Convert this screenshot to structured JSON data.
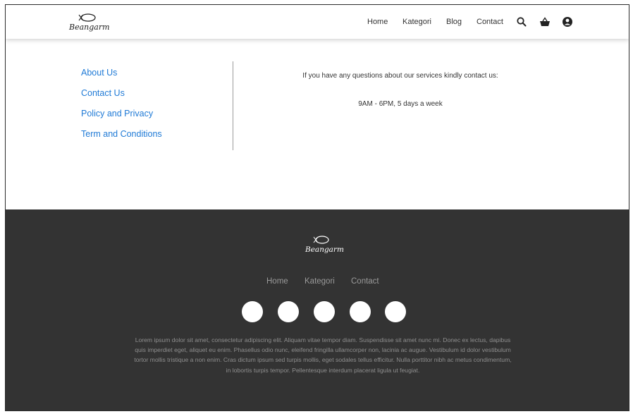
{
  "header": {
    "logo": {
      "text": "Beangarm"
    },
    "nav": [
      {
        "label": "Home"
      },
      {
        "label": "Kategori"
      },
      {
        "label": "Blog"
      },
      {
        "label": "Contact"
      }
    ],
    "icons": [
      "search-icon",
      "basket-icon",
      "user-icon"
    ]
  },
  "info": {
    "links": [
      {
        "label": "About Us"
      },
      {
        "label": "Contact Us"
      },
      {
        "label": "Policy and Privacy"
      },
      {
        "label": "Term and Conditions"
      }
    ],
    "contact_line": "If you have any questions about our services kindly contact us:",
    "hours": "9AM - 6PM, 5 days a week"
  },
  "footer": {
    "logo": {
      "text": "Beangarm"
    },
    "nav": [
      {
        "label": "Home"
      },
      {
        "label": "Kategori"
      },
      {
        "label": "Contact"
      }
    ],
    "social_count": 5,
    "text": "Lorem ipsum dolor sit amet, consectetur adipiscing elit. Aliquam vitae tempor diam. Suspendisse sit amet nunc mi. Donec ex lectus, dapibus quis imperdiet eget, aliquet eu enim. Phasellus odio nunc, eleifend fringilla ullamcorper non, lacinia ac augue. Vestibulum id dolor vestibulum tortor mollis tristique a non enim. Cras dictum ipsum sed turpis mollis, eget sodales tellus efficitur. Nulla porttitor nibh ac metus condimentum, in lobortis turpis tempor. Pellentesque interdum placerat ligula ut feugiat."
  },
  "colors": {
    "link_blue": "#1f7ad6",
    "footer_bg": "#333333"
  }
}
